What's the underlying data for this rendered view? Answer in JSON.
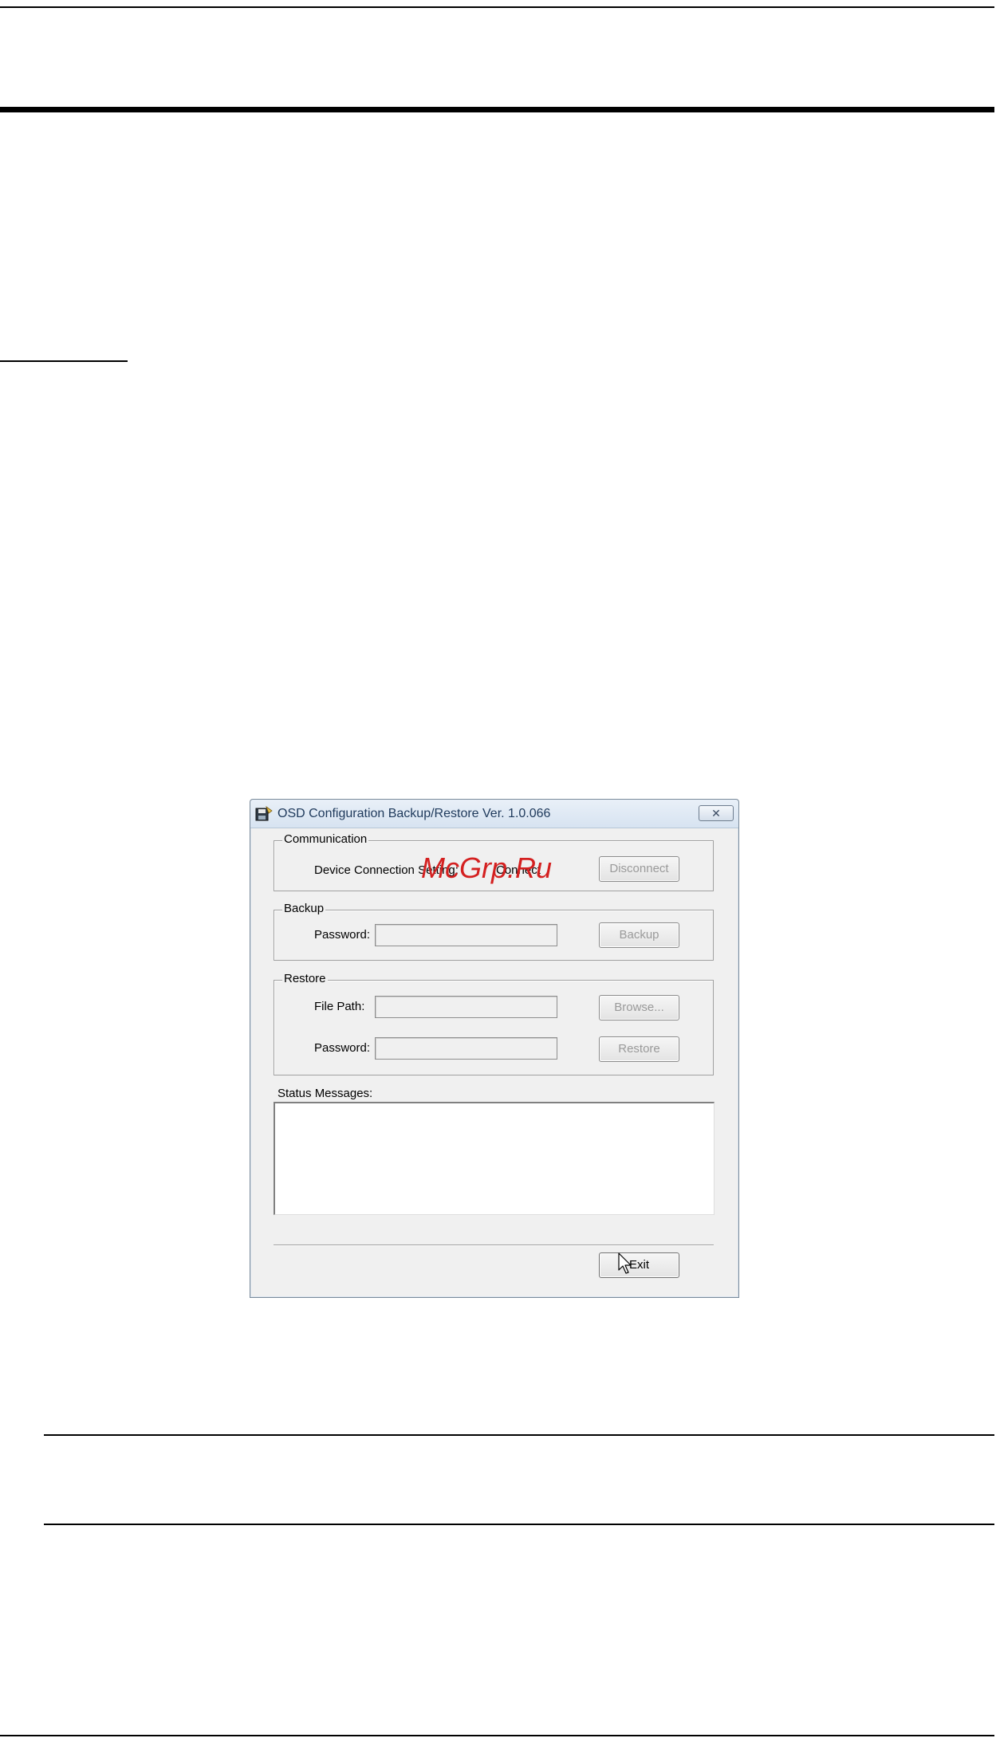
{
  "dialog": {
    "title": "OSD Configuration Backup/Restore   Ver. 1.0.066",
    "communication": {
      "legend": "Communication",
      "label": "Device Connection Setting:",
      "connect_label": "Connect",
      "disconnect_label": "Disconnect"
    },
    "backup": {
      "legend": "Backup",
      "password_label": "Password:",
      "password_value": "",
      "backup_label": "Backup"
    },
    "restore": {
      "legend": "Restore",
      "file_path_label": "File Path:",
      "file_path_value": "",
      "password_label": "Password:",
      "password_value": "",
      "browse_label": "Browse...",
      "restore_label": "Restore"
    },
    "status": {
      "label": "Status Messages:",
      "messages": ""
    },
    "exit_label": "Exit"
  },
  "watermark": "McGrp.Ru",
  "icons": {
    "app": "floppy-disk-icon",
    "close": "close-icon",
    "cursor": "mouse-pointer-icon"
  }
}
